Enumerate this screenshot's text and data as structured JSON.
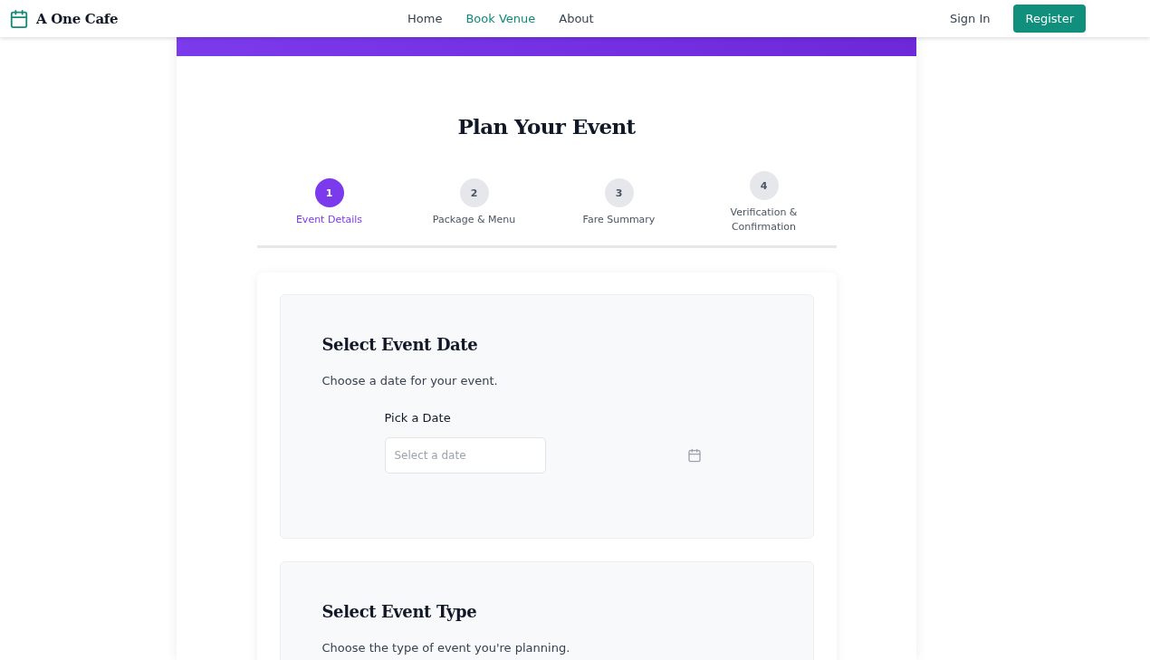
{
  "brand": {
    "name": "A One Cafe"
  },
  "nav": {
    "links": [
      {
        "label": "Home",
        "selected": false
      },
      {
        "label": "Book Venue",
        "selected": true
      },
      {
        "label": "About",
        "selected": false
      }
    ],
    "sign_in": "Sign In",
    "register": "Register"
  },
  "title": "Plan Your Event",
  "steps": [
    {
      "number": "1",
      "label": "Event Details",
      "selected": true
    },
    {
      "number": "2",
      "label": "Package & Menu",
      "selected": false
    },
    {
      "number": "3",
      "label": "Fare Summary",
      "selected": false
    },
    {
      "number": "4",
      "label": "Verification & Confirmation",
      "selected": false
    }
  ],
  "sections": [
    {
      "kind": "date",
      "title": "Select Event Date",
      "description": "Choose a date for your event.",
      "field_label": "Pick a Date",
      "placeholder": "Select a date"
    },
    {
      "kind": "text",
      "title": "Select Event Type",
      "description": "Choose the type of event you're planning."
    }
  ]
}
